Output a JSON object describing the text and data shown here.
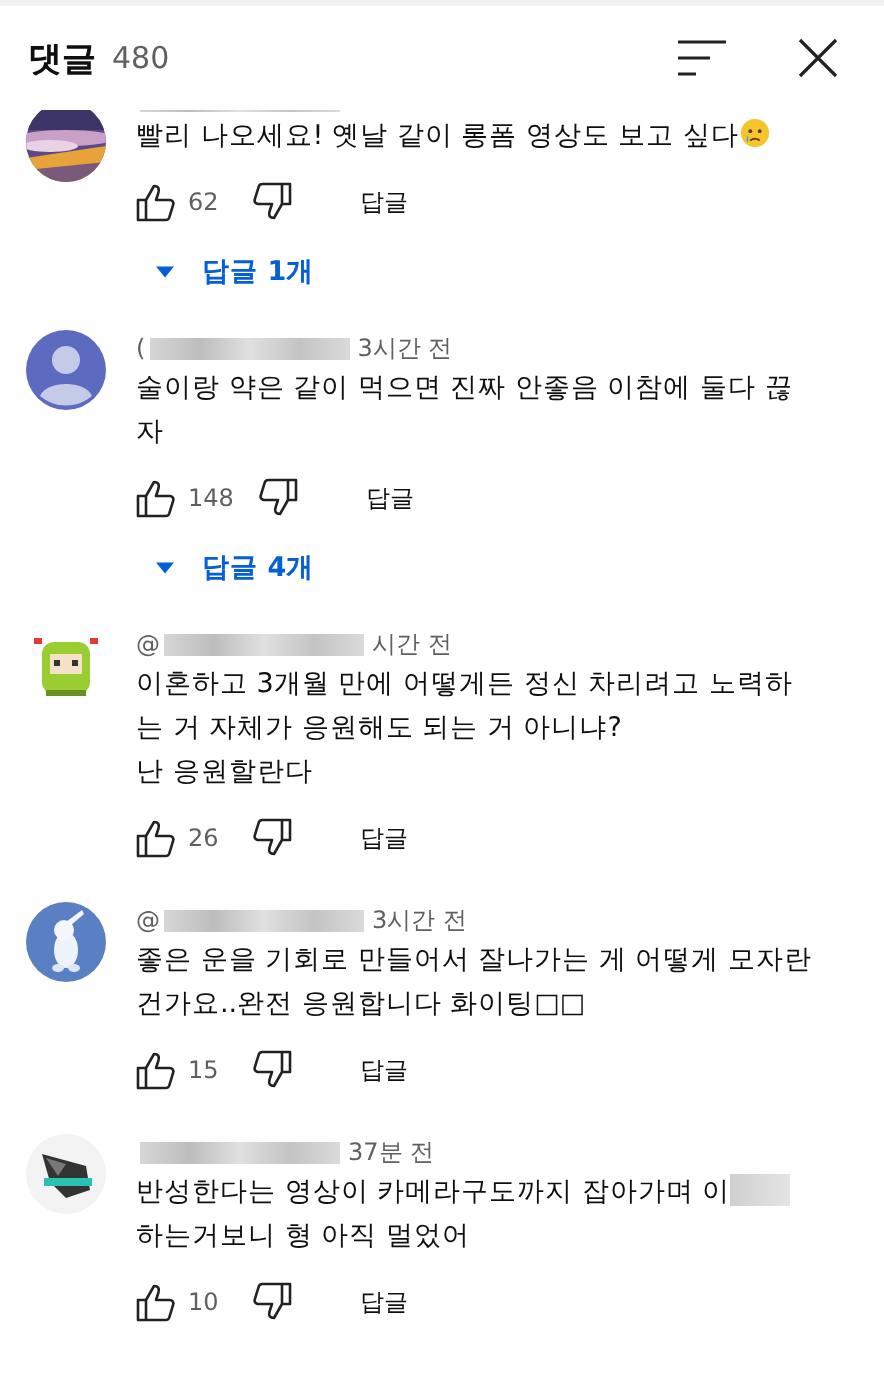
{
  "header": {
    "title": "댓글",
    "count": "480"
  },
  "comments": [
    {
      "avatar": {
        "kind": "sunset"
      },
      "body": [
        {
          "kind": "text",
          "text": "빨리 나오세요! 옛날 같이 롱폼 영상도 보고 싶다"
        },
        {
          "kind": "emoji"
        }
      ],
      "likes": "62",
      "reply": "답글",
      "replies": "답글 1개"
    },
    {
      "avatar": {
        "kind": "default"
      },
      "name_prefix": "(",
      "time": "3시간 전",
      "body": [
        {
          "kind": "text",
          "text": "술이랑 약은 같이 먹으면 진짜 안좋음 이참에 둘다 끊자"
        }
      ],
      "likes": "148",
      "reply": "답글",
      "replies": "답글 4개"
    },
    {
      "avatar": {
        "kind": "pixel"
      },
      "name_prefix": "@",
      "time": "시간 전",
      "body": [
        {
          "kind": "text",
          "text": "이혼하고 3개월 만에 어떻게든 정신 차리려고 노력하는 거 자체가 응원해도 되는 거 아니냐?\n난 응원할란다"
        }
      ],
      "likes": "26",
      "reply": "답글"
    },
    {
      "avatar": {
        "kind": "rabbit"
      },
      "name_prefix": "@",
      "time": "3시간 전",
      "body": [
        {
          "kind": "text",
          "text": "좋은 운을 기회로 만들어서 잘나가는 게 어떻게 모자란 건가요..완전 응원합니다 화이팅□□"
        }
      ],
      "likes": "15",
      "reply": "답글"
    },
    {
      "avatar": {
        "kind": "wolf"
      },
      "time": "37분 전",
      "body": [
        {
          "kind": "text",
          "text": "반성한다는 영상이 카메라구도까지 잡아가며 이"
        },
        {
          "kind": "blur"
        },
        {
          "kind": "text",
          "text": "하는거보니 형 아직 멀었어"
        }
      ],
      "likes": "10",
      "reply": "답글"
    }
  ]
}
